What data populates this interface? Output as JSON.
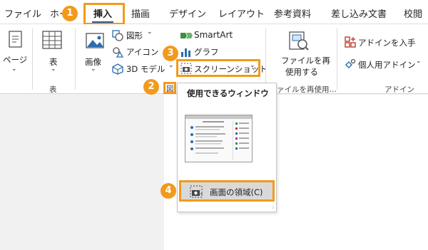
{
  "tabs": [
    {
      "label": "ファイル"
    },
    {
      "label": "ホー"
    },
    {
      "label": "挿入"
    },
    {
      "label": "描画"
    },
    {
      "label": "デザイン"
    },
    {
      "label": "レイアウト"
    },
    {
      "label": "参考資料"
    },
    {
      "label": "差し込み文書"
    },
    {
      "label": "校閲"
    }
  ],
  "ribbon": {
    "pages_label": "ページ",
    "table_label": "表",
    "table_group": "表",
    "image_label": "画像",
    "shape_label": "図形",
    "icon_label": "アイコン",
    "model3d_label": "3D モデル",
    "smartart_label": "SmartArt",
    "graph_label": "グラフ",
    "screenshot_label": "スクリーンショット",
    "figure_group_partial": "図",
    "reuse_label_1": "ファイルを再",
    "reuse_label_2": "使用する",
    "reuse_group": "ァイルを再使用…",
    "getaddins_label": "アドインを入手",
    "personal_addins_label": "個人用アドイン",
    "addins_group": "アドイン"
  },
  "dropdown": {
    "title": "使用できるウィンドウ",
    "clipping_label": "画面の領域(C)"
  },
  "badges": [
    "1",
    "2",
    "3",
    "4"
  ],
  "colors": {
    "accent": "#f29a1c",
    "tab_underline": "#2b579a"
  }
}
